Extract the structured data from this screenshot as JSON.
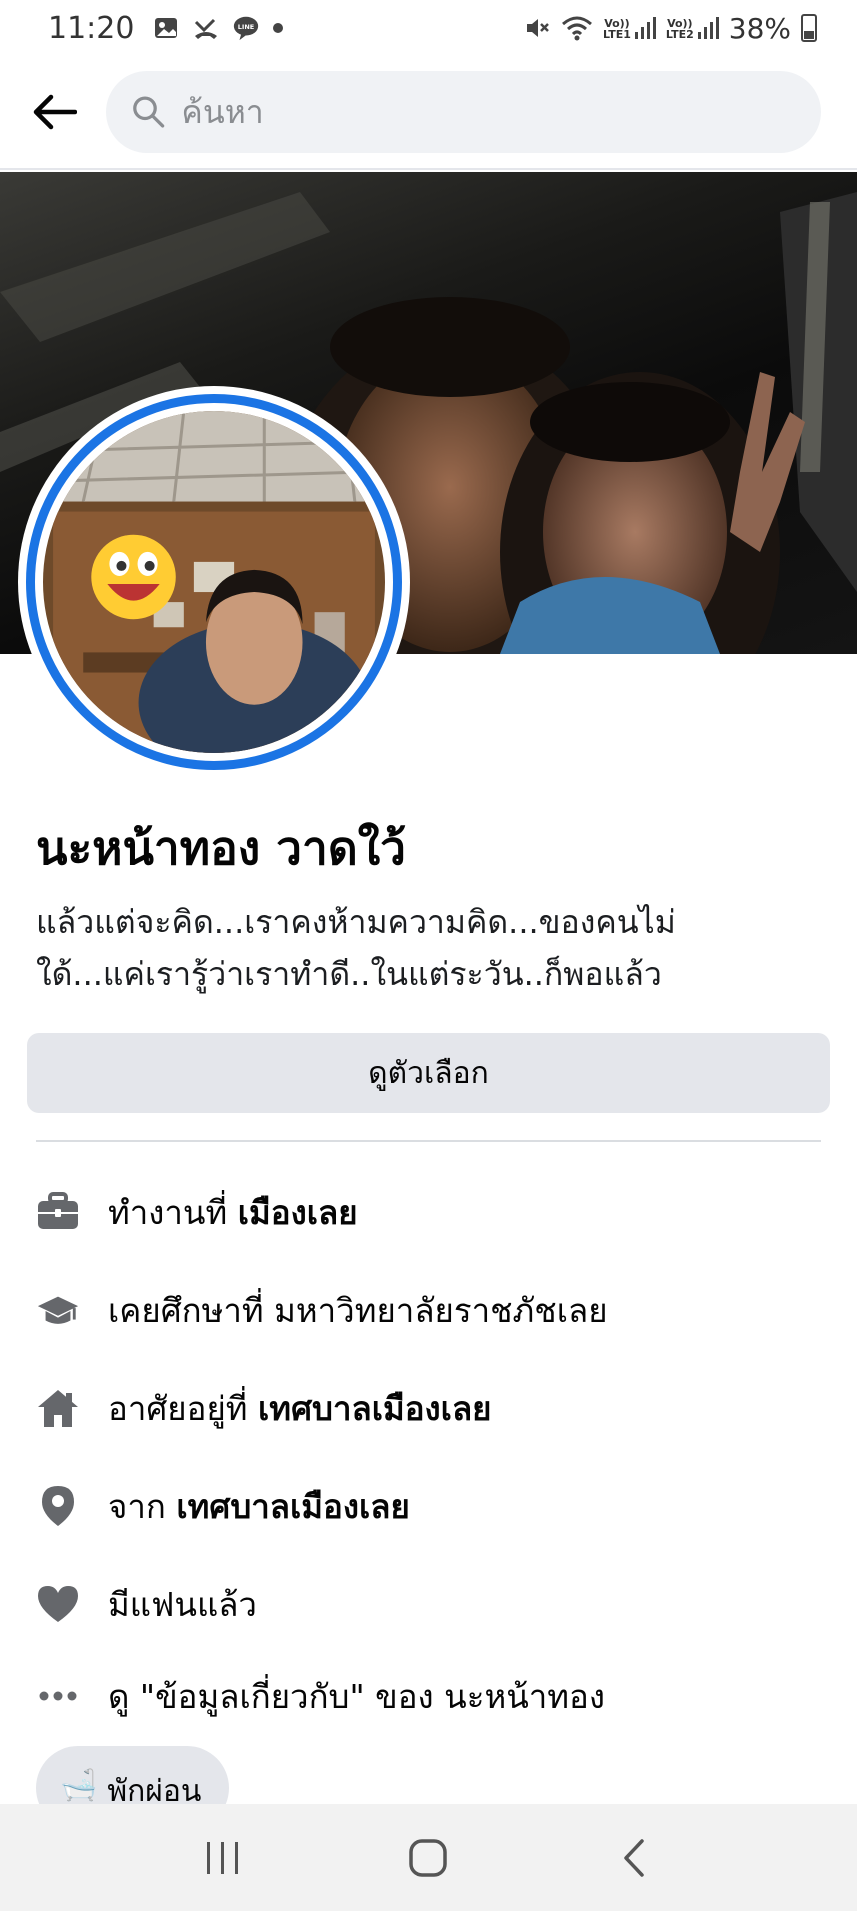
{
  "status_bar": {
    "time": "11:20",
    "battery": "38%",
    "sim1": "LTE1",
    "sim2": "LTE2",
    "volte": "Vo))"
  },
  "header": {
    "search_placeholder": "ค้นหา"
  },
  "profile": {
    "name": "นะหน้าทอง วาดใว้",
    "bio_line1": "แล้วแต่จะคิด...เราคงห้ามความคิด...ของคนไม่",
    "bio_line2": "ใด้...แค่เรารู้ว่าเราทำดี..ในแต่ระวัน..ก็พอแล้ว",
    "options_button": "ดูตัวเลือก"
  },
  "info": {
    "work_prefix": "ทำงานที่ ",
    "work_value": "เมืองเลย",
    "education": "เคยศึกษาที่ มหาวิทยาลัยราชภัชเลย",
    "lives_prefix": "อาศัยอยู่ที่ ",
    "lives_value": "เทศบาลเมืองเลย",
    "from_prefix": "จาก ",
    "from_value": "เทศบาลเมืองเลย",
    "relationship": "มีแฟนแล้ว",
    "about_link": "ดู \"ข้อมูลเกี่ยวกับ\" ของ นะหน้าทอง"
  },
  "chip": {
    "emoji": "🛁",
    "label": "พักผ่อน"
  },
  "colors": {
    "accent": "#1b74e4",
    "icon_gray": "#65676b",
    "button_bg": "#e4e6eb"
  }
}
